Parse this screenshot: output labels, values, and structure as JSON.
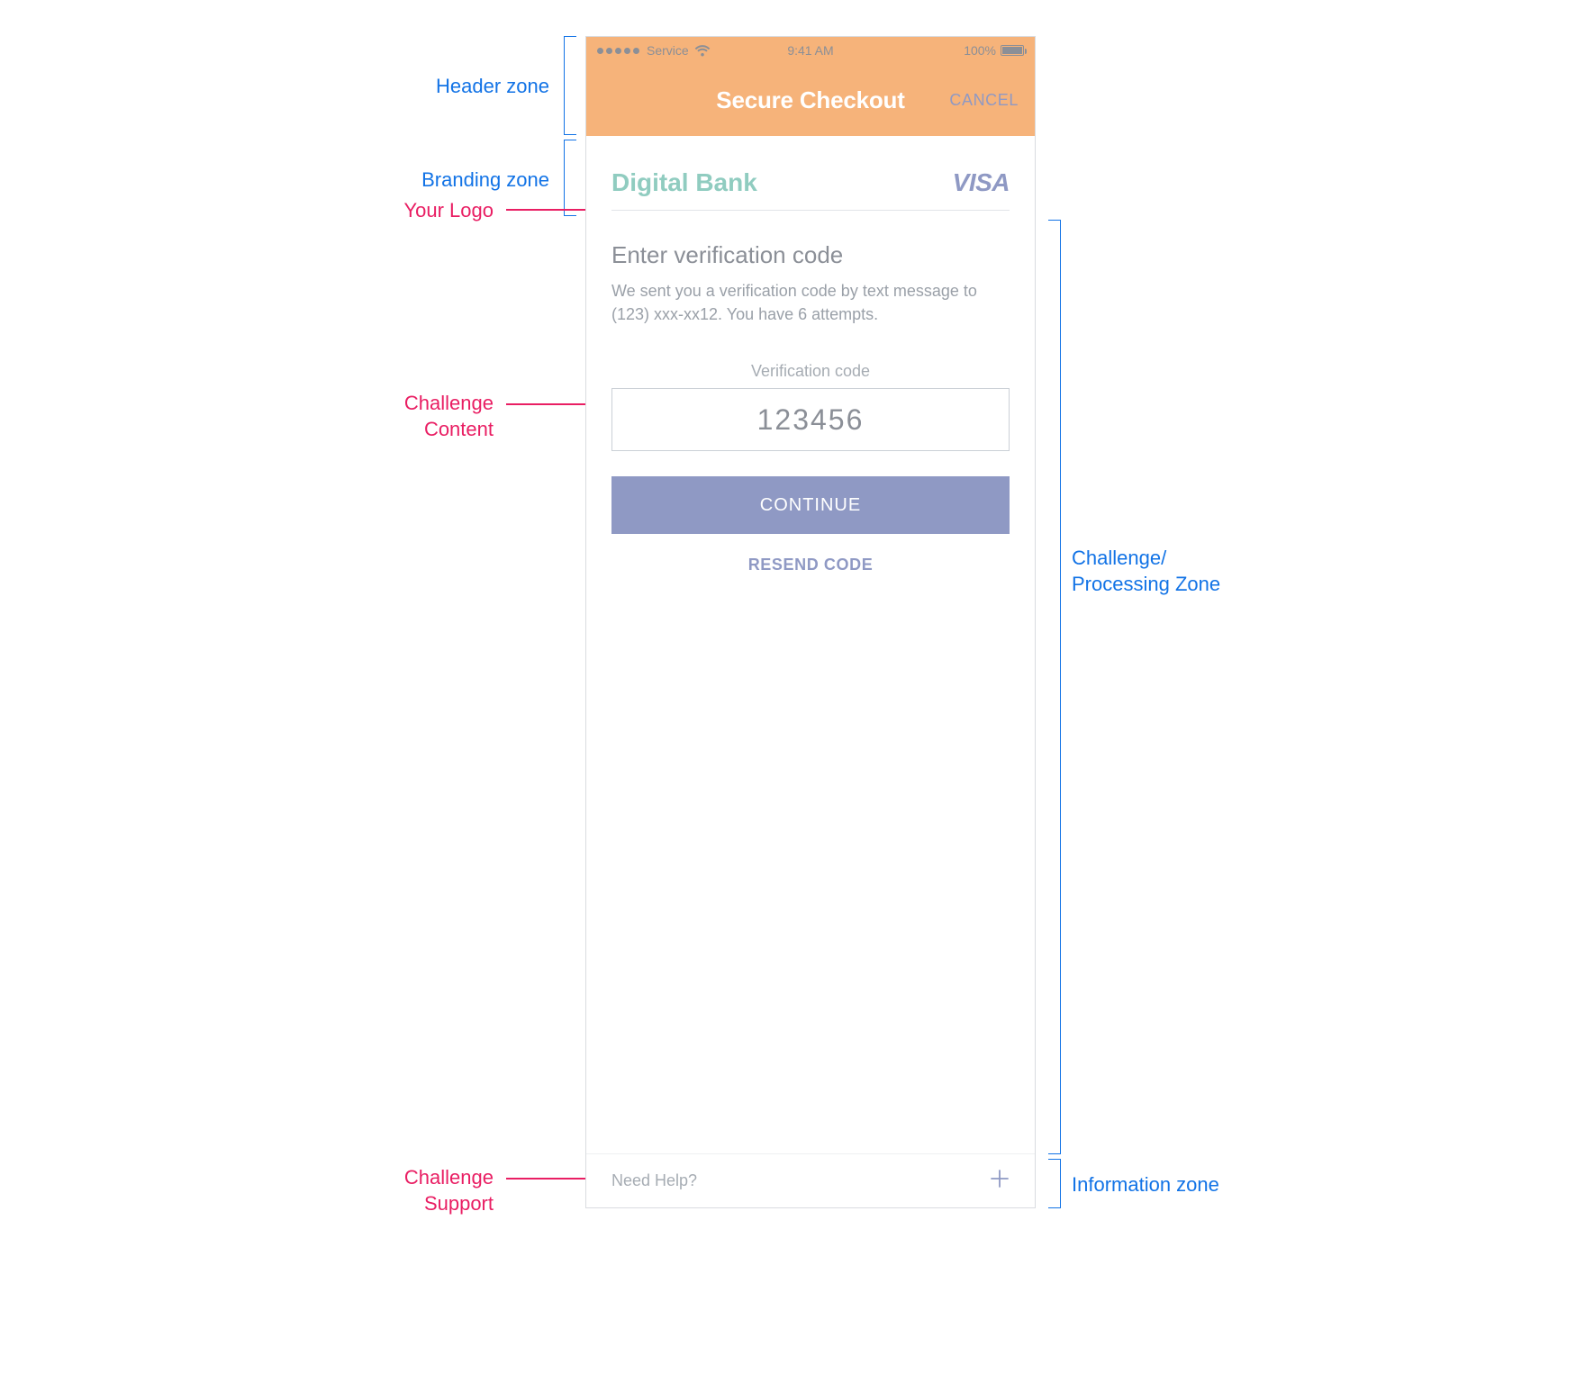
{
  "annotations": {
    "header_zone": "Header zone",
    "branding_zone": "Branding zone",
    "your_logo": "Your Logo",
    "challenge_content_l1": "Challenge",
    "challenge_content_l2": "Content",
    "challenge_processing_l1": "Challenge/",
    "challenge_processing_l2": "Processing Zone",
    "information_zone": "Information zone",
    "challenge_support_l1": "Challenge",
    "challenge_support_l2": "Support"
  },
  "statusbar": {
    "carrier": "Service",
    "time": "9:41 AM",
    "battery": "100%"
  },
  "header": {
    "title": "Secure Checkout",
    "cancel": "CANCEL"
  },
  "branding": {
    "bank_name": "Digital Bank",
    "network": "VISA"
  },
  "challenge": {
    "heading": "Enter verification code",
    "description": "We sent you a verification code by text message to (123) xxx-xx12. You have 6 attempts.",
    "input_label": "Verification code",
    "input_value": "123456",
    "continue": "CONTINUE",
    "resend": "RESEND CODE"
  },
  "footer": {
    "help": "Need Help?"
  }
}
